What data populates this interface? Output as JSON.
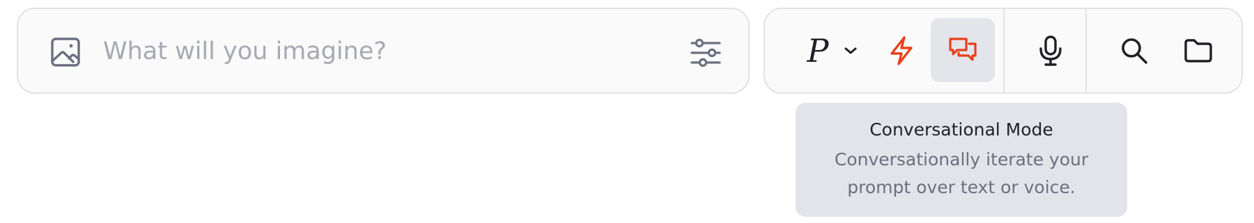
{
  "prompt": {
    "placeholder": "What will you imagine?",
    "value": ""
  },
  "toolbar": {
    "model_letter": "P",
    "active_tool": "conversational-mode"
  },
  "tooltip": {
    "title": "Conversational Mode",
    "description": "Conversationally iterate your prompt over text or voice."
  },
  "icons": {
    "image": "image-icon",
    "settings": "sliders-icon",
    "chevron": "chevron-down-icon",
    "boost": "lightning-icon",
    "chat": "chat-bubbles-icon",
    "mic": "microphone-icon",
    "search": "search-icon",
    "folder": "folder-icon"
  },
  "colors": {
    "accent": "#e8401c",
    "icon_gray": "#6b6f80",
    "placeholder": "#a7a9b2",
    "active_bg": "#e4e5ea",
    "border": "#e2e2e6",
    "surface": "#fafafa",
    "tooltip_bg": "#e3e4e9"
  }
}
